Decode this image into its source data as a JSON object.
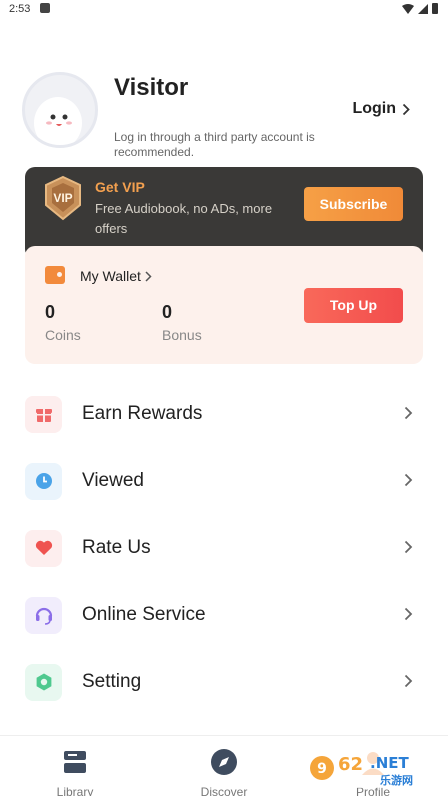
{
  "status_bar": {
    "time": "2:53"
  },
  "profile": {
    "username": "Visitor",
    "login_label": "Login",
    "login_hint": "Log in through a third party account is recommended."
  },
  "vip": {
    "badge_text": "VIP",
    "title": "Get VIP",
    "description": "Free Audiobook, no ADs, more offers",
    "subscribe_label": "Subscribe",
    "accent_color": "#f3a04f"
  },
  "wallet": {
    "title": "My Wallet",
    "coins_value": "0",
    "coins_label": "Coins",
    "bonus_value": "0",
    "bonus_label": "Bonus",
    "topup_label": "Top Up"
  },
  "menu": {
    "items": [
      {
        "label": "Earn Rewards",
        "icon": "gift-icon",
        "color": "#f06a6a"
      },
      {
        "label": "Viewed",
        "icon": "clock-icon",
        "color": "#4aa3e8"
      },
      {
        "label": "Rate Us",
        "icon": "heart-icon",
        "color": "#ef5350"
      },
      {
        "label": "Online Service",
        "icon": "headset-icon",
        "color": "#8b6ee8"
      },
      {
        "label": "Setting",
        "icon": "settings-icon",
        "color": "#4fc98f"
      }
    ]
  },
  "bottom_nav": {
    "items": [
      {
        "label": "Library",
        "icon": "library-icon"
      },
      {
        "label": "Discover",
        "icon": "compass-icon"
      },
      {
        "label": "Profile",
        "icon": "profile-icon"
      }
    ]
  },
  "watermark": {
    "brand": "962.NET",
    "subtitle": "乐游网"
  }
}
